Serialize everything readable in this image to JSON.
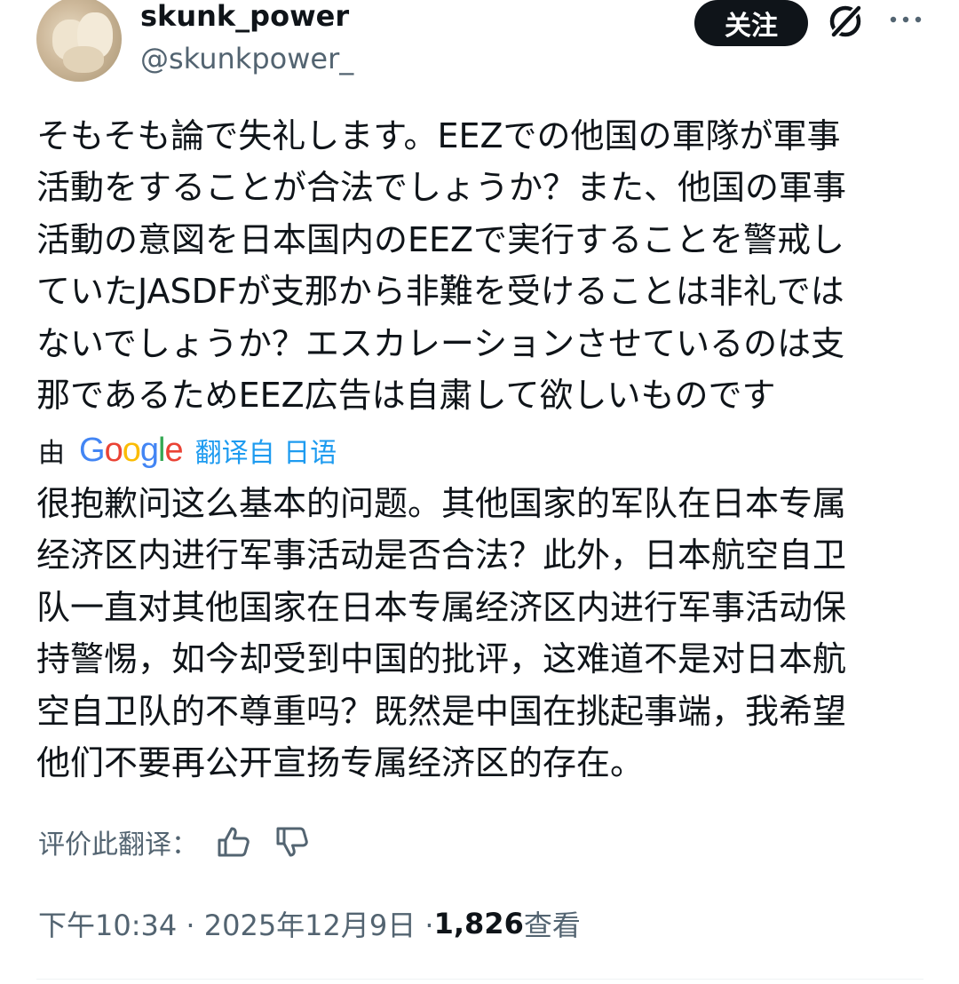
{
  "author": {
    "display_name": "skunk_power",
    "handle": "@skunkpower_",
    "avatar": "avatar-photo"
  },
  "header": {
    "follow_label": "关注",
    "icons": [
      "grok-icon",
      "more-icon"
    ]
  },
  "tweet": {
    "text": "そもそも論で失礼します。EEZでの他国の軍隊が軍事\n活動をすることが合法でしょうか？また、他国の軍事\n活動の意図を日本国内のEEZで実行することを警戒し\nていたJASDFが支那から非難を受けることは非礼では\nないでしょうか？エスカレーションさせているのは支\n那であるためEEZ広告は自粛して欲しいものです"
  },
  "translation": {
    "by_label": "由",
    "provider_letters": [
      "G",
      "o",
      "o",
      "g",
      "l",
      "e"
    ],
    "provider_colors": [
      "#4285F4",
      "#EA4335",
      "#FBBC05",
      "#4285F4",
      "#34A853",
      "#EA4335"
    ],
    "source_label": "翻译自 日语",
    "text": "很抱歉问这么基本的问题。其他国家的军队在日本专属\n经济区内进行军事活动是否合法？此外，日本航空自卫\n队一直对其他国家在日本专属经济区内进行军事活动保\n持警惕，如今却受到中国的批评，这难道不是对日本航\n空自卫队的不尊重吗？既然是中国在挑起事端，我希望\n他们不要再公开宣扬专属经济区的存在。",
    "rate_label": "评价此翻译：",
    "rate_icons": [
      "thumbs-up-icon",
      "thumbs-down-icon"
    ]
  },
  "meta": {
    "time_date": "下午10:34 · 2025年12月9日 · ",
    "views_count": "1,826",
    "views_label": " 查看"
  }
}
